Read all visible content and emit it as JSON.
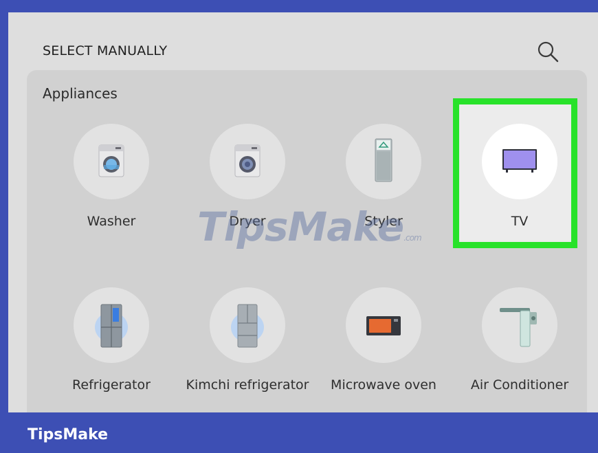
{
  "header": {
    "title": "SELECT MANUALLY",
    "search_icon": "search-icon"
  },
  "section": {
    "title": "Appliances"
  },
  "appliances": [
    {
      "label": "Washer",
      "icon": "washer-icon"
    },
    {
      "label": "Dryer",
      "icon": "dryer-icon"
    },
    {
      "label": "Styler",
      "icon": "styler-icon"
    },
    {
      "label": "TV",
      "icon": "tv-icon",
      "selected": true
    },
    {
      "label": "Refrigerator",
      "icon": "refrigerator-icon"
    },
    {
      "label": "Kimchi refrigerator",
      "icon": "kimchi-refrigerator-icon"
    },
    {
      "label": "Microwave oven",
      "icon": "microwave-icon"
    },
    {
      "label": "Air Conditioner",
      "icon": "air-conditioner-icon"
    }
  ],
  "watermark": {
    "text": "TipsMake",
    "suffix": ".com"
  },
  "footer": {
    "brand": "TipsMake"
  },
  "colors": {
    "frame": "#3d4fb4",
    "highlight": "#28e22a",
    "panel": "#d1d1d1",
    "screen": "#dedede"
  }
}
